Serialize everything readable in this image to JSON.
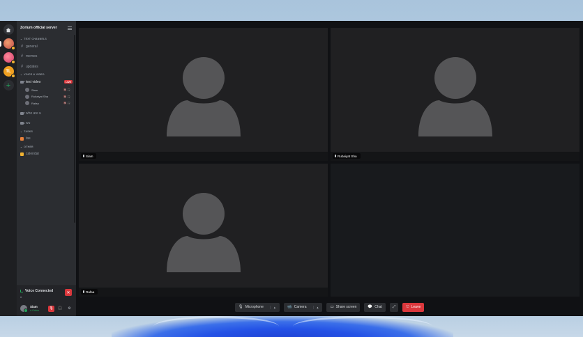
{
  "server": {
    "name": "Zorium official server",
    "rail": [
      {
        "name": "home",
        "label": ""
      },
      {
        "name": "server-1",
        "label": ""
      },
      {
        "name": "server-2",
        "label": ""
      },
      {
        "name": "server-3",
        "label": "TL"
      }
    ]
  },
  "categories": {
    "text": "TEXT CHANNELS",
    "voice": "VOICE & VIDEO",
    "tasks": "TASKS",
    "other": "OTHER"
  },
  "text_channels": [
    "general",
    "memes",
    "updates"
  ],
  "voice_channels": [
    {
      "name": "test video",
      "badge": "LIVE"
    },
    {
      "name": "who are u"
    },
    {
      "name": "wu"
    }
  ],
  "voice_users": [
    {
      "name": "Siam",
      "status": "🔇 🎧"
    },
    {
      "name": "Rubaiyat Sha",
      "status": "🔇 🎧"
    },
    {
      "name": "Rafaa",
      "status": "🔇 🎧"
    }
  ],
  "task_channels": [
    "tas"
  ],
  "other_channels": [
    "calendar"
  ],
  "voice_panel": {
    "title": "Voice Connected",
    "subtitle": "#"
  },
  "user": {
    "name": "Siam",
    "status": "● Online"
  },
  "tiles": [
    {
      "name": "Siam"
    },
    {
      "name": "Rubaiyat Sha"
    },
    {
      "name": "Rafaa"
    }
  ],
  "controls": {
    "microphone": "Microphone",
    "camera": "Camera",
    "share_screen": "Share screen",
    "chat": "Chat",
    "leave": "Leave"
  },
  "colors": {
    "accent_red": "#da373c",
    "online_green": "#23a55a",
    "sidebar": "#2b2d31",
    "tile": "#202022"
  }
}
